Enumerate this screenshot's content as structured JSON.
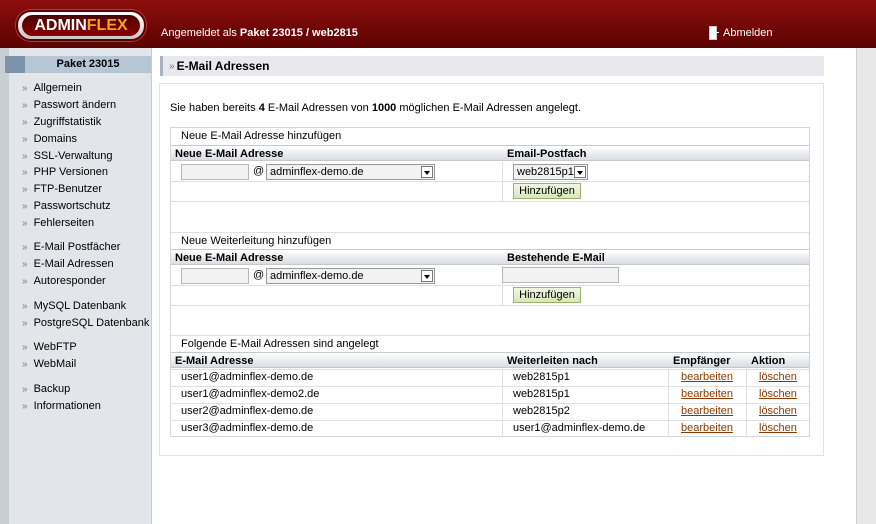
{
  "header": {
    "logo_part1": "ADMIN",
    "logo_part2": "FLEX",
    "login_prefix": "Angemeldet als",
    "login_user": "Paket 23015 / web2815",
    "logout_label": "Abmelden"
  },
  "sidebar": {
    "package_label": "Paket 23015",
    "groups": [
      [
        "Allgemein",
        "Passwort ändern",
        "Zugriffstatistik",
        "Domains",
        "SSL-Verwaltung",
        "PHP Versionen",
        "FTP-Benutzer",
        "Passwortschutz",
        "Fehlerseiten"
      ],
      [
        "E-Mail Postfächer",
        "E-Mail Adressen",
        "Autoresponder"
      ],
      [
        "MySQL Datenbank",
        "PostgreSQL Datenbank"
      ],
      [
        "WebFTP",
        "WebMail"
      ],
      [
        "Backup",
        "Informationen"
      ]
    ]
  },
  "page": {
    "title": "E-Mail Adressen",
    "intro_a": "Sie haben bereits",
    "used": "4",
    "intro_b": "E-Mail Adressen von",
    "max": "1000",
    "intro_c": "möglichen E-Mail Adressen angelegt."
  },
  "add_address": {
    "title": "Neue E-Mail Adresse hinzufügen",
    "col1": "Neue E-Mail Adresse",
    "col2": "Email-Postfach",
    "at": "@",
    "domain": "adminflex-demo.de",
    "mailbox": "web2815p1",
    "button": "Hinzufügen"
  },
  "add_forward": {
    "title": "Neue Weiterleitung hinzufügen",
    "col1": "Neue E-Mail Adresse",
    "col2": "Bestehende E-Mail",
    "at": "@",
    "domain": "adminflex-demo.de",
    "button": "Hinzufügen"
  },
  "list": {
    "title": "Folgende E-Mail Adressen sind angelegt",
    "headers": [
      "E-Mail Adresse",
      "Weiterleiten nach",
      "Empfänger",
      "Aktion"
    ],
    "rows": [
      {
        "address": "user1@adminflex-demo.de",
        "forward": "web2815p1",
        "edit": "bearbeiten",
        "delete": "löschen"
      },
      {
        "address": "user1@adminflex-demo2.de",
        "forward": "web2815p1",
        "edit": "bearbeiten",
        "delete": "löschen"
      },
      {
        "address": "user2@adminflex-demo.de",
        "forward": "web2815p2",
        "edit": "bearbeiten",
        "delete": "löschen"
      },
      {
        "address": "user3@adminflex-demo.de",
        "forward": "user1@adminflex-demo.de",
        "edit": "bearbeiten",
        "delete": "löschen"
      }
    ]
  }
}
